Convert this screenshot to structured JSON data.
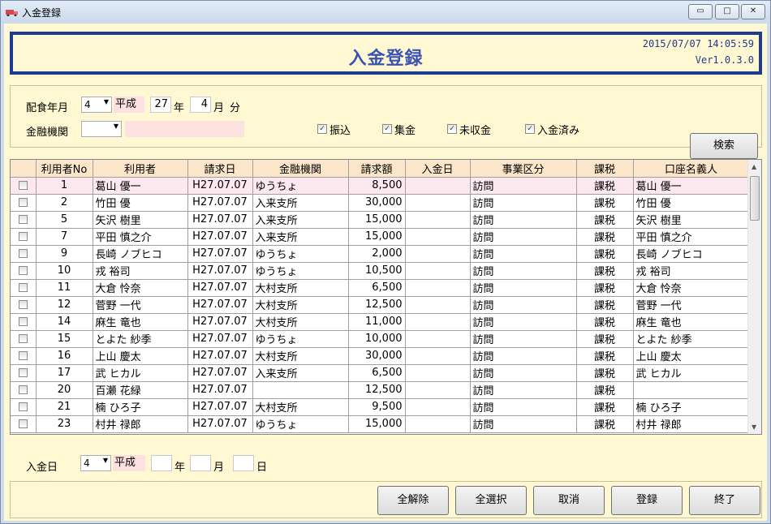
{
  "window": {
    "title": "入金登録",
    "min_icon": "minimize-icon",
    "max_icon": "maximize-icon",
    "close_icon": "close-icon",
    "min_glyph": "▭",
    "max_glyph": "□",
    "close_glyph": "✕"
  },
  "header": {
    "title": "入金登録",
    "datetime": "2015/07/07 14:05:59",
    "version": "Ver1.0.3.0"
  },
  "search": {
    "meal_month_label": "配食年月",
    "era_code": "4",
    "era_name": "平成",
    "year_value": "27",
    "year_label": "年",
    "month_value": "4",
    "month_label": "月",
    "portion_label": "分",
    "bank_label": "金融機関",
    "bank_value": "",
    "bank_name_display": "",
    "checkboxes": [
      {
        "label": "振込",
        "checked": true
      },
      {
        "label": "集金",
        "checked": true
      },
      {
        "label": "未収金",
        "checked": true
      },
      {
        "label": "入金済み",
        "checked": true
      }
    ],
    "search_button": "検索"
  },
  "grid": {
    "columns": [
      "",
      "利用者No",
      "利用者",
      "請求日",
      "金融機関",
      "請求額",
      "入金日",
      "事業区分",
      "課税",
      "口座名義人"
    ],
    "rows": [
      {
        "no": "1",
        "user": "葛山 優一",
        "date": "H27.07.07",
        "bank": "ゆうちょ",
        "amount": "8,500",
        "paid": "",
        "biz": "訪問",
        "tax": "課税",
        "holder": "葛山 優一"
      },
      {
        "no": "2",
        "user": "竹田 優",
        "date": "H27.07.07",
        "bank": "入来支所",
        "amount": "30,000",
        "paid": "",
        "biz": "訪問",
        "tax": "課税",
        "holder": "竹田 優"
      },
      {
        "no": "5",
        "user": "矢沢 樹里",
        "date": "H27.07.07",
        "bank": "入来支所",
        "amount": "15,000",
        "paid": "",
        "biz": "訪問",
        "tax": "課税",
        "holder": "矢沢 樹里"
      },
      {
        "no": "7",
        "user": "平田 慎之介",
        "date": "H27.07.07",
        "bank": "入来支所",
        "amount": "15,000",
        "paid": "",
        "biz": "訪問",
        "tax": "課税",
        "holder": "平田 慎之介"
      },
      {
        "no": "9",
        "user": "長崎 ノブヒコ",
        "date": "H27.07.07",
        "bank": "ゆうちょ",
        "amount": "2,000",
        "paid": "",
        "biz": "訪問",
        "tax": "課税",
        "holder": "長崎 ノブヒコ"
      },
      {
        "no": "10",
        "user": "戎 裕司",
        "date": "H27.07.07",
        "bank": "ゆうちょ",
        "amount": "10,500",
        "paid": "",
        "biz": "訪問",
        "tax": "課税",
        "holder": "戎 裕司"
      },
      {
        "no": "11",
        "user": "大倉 怜奈",
        "date": "H27.07.07",
        "bank": "大村支所",
        "amount": "6,500",
        "paid": "",
        "biz": "訪問",
        "tax": "課税",
        "holder": "大倉 怜奈"
      },
      {
        "no": "12",
        "user": "菅野 一代",
        "date": "H27.07.07",
        "bank": "大村支所",
        "amount": "12,500",
        "paid": "",
        "biz": "訪問",
        "tax": "課税",
        "holder": "菅野 一代"
      },
      {
        "no": "14",
        "user": "麻生 竜也",
        "date": "H27.07.07",
        "bank": "大村支所",
        "amount": "11,000",
        "paid": "",
        "biz": "訪問",
        "tax": "課税",
        "holder": "麻生 竜也"
      },
      {
        "no": "15",
        "user": "とよた 紗季",
        "date": "H27.07.07",
        "bank": "ゆうちょ",
        "amount": "10,000",
        "paid": "",
        "biz": "訪問",
        "tax": "課税",
        "holder": "とよた 紗季"
      },
      {
        "no": "16",
        "user": "上山 慶太",
        "date": "H27.07.07",
        "bank": "大村支所",
        "amount": "30,000",
        "paid": "",
        "biz": "訪問",
        "tax": "課税",
        "holder": "上山 慶太"
      },
      {
        "no": "17",
        "user": "武 ヒカル",
        "date": "H27.07.07",
        "bank": "入来支所",
        "amount": "6,500",
        "paid": "",
        "biz": "訪問",
        "tax": "課税",
        "holder": "武 ヒカル"
      },
      {
        "no": "20",
        "user": "百瀬 花緑",
        "date": "H27.07.07",
        "bank": "",
        "amount": "12,500",
        "paid": "",
        "biz": "訪問",
        "tax": "課税",
        "holder": ""
      },
      {
        "no": "21",
        "user": "楠 ひろ子",
        "date": "H27.07.07",
        "bank": "大村支所",
        "amount": "9,500",
        "paid": "",
        "biz": "訪問",
        "tax": "課税",
        "holder": "楠 ひろ子"
      },
      {
        "no": "23",
        "user": "村井 禄郎",
        "date": "H27.07.07",
        "bank": "ゆうちょ",
        "amount": "15,000",
        "paid": "",
        "biz": "訪問",
        "tax": "課税",
        "holder": "村井 禄郎"
      }
    ]
  },
  "payment": {
    "label": "入金日",
    "era_code": "4",
    "era_name": "平成",
    "year_value": "",
    "year_label": "年",
    "month_value": "",
    "month_label": "月",
    "day_value": "",
    "day_label": "日"
  },
  "buttons": {
    "unselect_all": "全解除",
    "select_all": "全選択",
    "cancel": "取消",
    "register": "登録",
    "exit": "終了"
  },
  "colors": {
    "client_bg": "#fff8d2",
    "header_border": "#1d3b8f",
    "header_title": "#3a54b4",
    "grid_header": "#fbe6c9",
    "selected_row": "#fde8ef",
    "pink_label": "#fde1e1"
  }
}
